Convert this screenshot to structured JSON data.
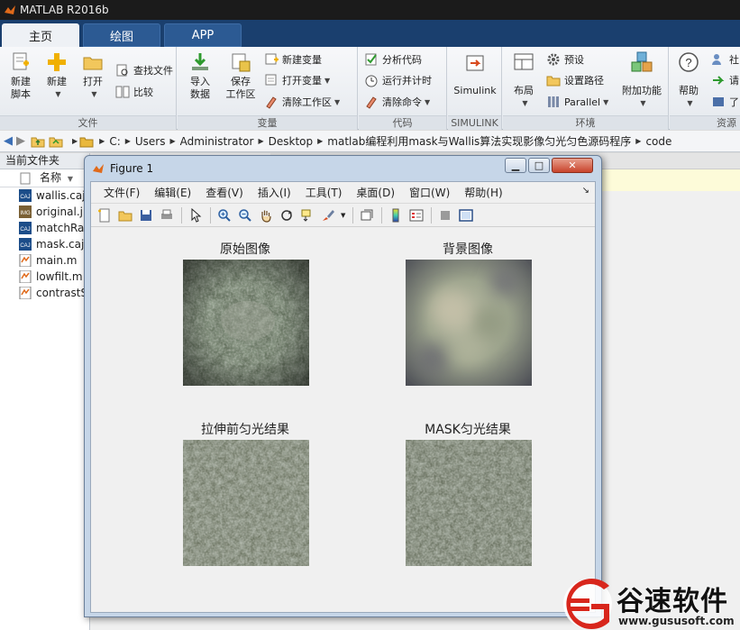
{
  "app": {
    "title": "MATLAB R2016b"
  },
  "tabs": [
    {
      "label": "主页"
    },
    {
      "label": "绘图"
    },
    {
      "label": "APP"
    }
  ],
  "ribbon": {
    "file_group": {
      "label": "文件",
      "new_script": "新建\n脚本",
      "new": "新建",
      "open": "打开",
      "find_files": "查找文件",
      "compare": "比较"
    },
    "variable_group": {
      "label": "变量",
      "import_data": "导入\n数据",
      "save_workspace": "保存\n工作区",
      "new_variable": "新建变量",
      "open_variable": "打开变量",
      "clear_workspace": "清除工作区"
    },
    "code_group": {
      "label": "代码",
      "analyze_code": "分析代码",
      "run_and_time": "运行并计时",
      "clear_commands": "清除命令"
    },
    "simulink_group": {
      "label": "SIMULINK",
      "simulink": "Simulink"
    },
    "env_group": {
      "label": "环境",
      "layout": "布局",
      "preferences": "预设",
      "set_path": "设置路径",
      "parallel": "Parallel",
      "addons": "附加功能"
    },
    "resources_group": {
      "label": "资源",
      "help": "帮助",
      "community": "社",
      "request": "请",
      "learn": "了"
    }
  },
  "address": {
    "segments": [
      "C:",
      "Users",
      "Administrator",
      "Desktop",
      "matlab编程利用mask与Wallis算法实现影像匀光匀色源码程序",
      "code"
    ]
  },
  "file_panel": {
    "title": "当前文件夹",
    "column": "名称",
    "files": [
      {
        "name": "wallis.caj",
        "icon": "caj-file-icon"
      },
      {
        "name": "original.j",
        "icon": "image-file-icon"
      },
      {
        "name": "matchRa",
        "icon": "caj-file-icon"
      },
      {
        "name": "mask.caj",
        "icon": "caj-file-icon"
      },
      {
        "name": "main.m",
        "icon": "m-file-icon"
      },
      {
        "name": "lowfilt.m",
        "icon": "m-file-icon"
      },
      {
        "name": "contrastS",
        "icon": "m-file-icon"
      }
    ]
  },
  "figure": {
    "title": "Figure 1",
    "menu": [
      "文件(F)",
      "编辑(E)",
      "查看(V)",
      "插入(I)",
      "工具(T)",
      "桌面(D)",
      "窗口(W)",
      "帮助(H)"
    ],
    "axes": [
      {
        "title": "原始图像",
        "kind": "original"
      },
      {
        "title": "背景图像",
        "kind": "background"
      },
      {
        "title": "拉伸前匀光结果",
        "kind": "pre-stretch"
      },
      {
        "title": "MASK匀光结果",
        "kind": "mask-result"
      }
    ]
  },
  "watermark": {
    "brand": "谷速软件",
    "url": "www.gususoft.com"
  },
  "colors": {
    "titlebar": "#1b1b1b",
    "tabbar": "#1a3f6e",
    "ribbon": "#eef1f5",
    "figure_frame": "#c6d6e8",
    "watermark_red": "#d8261c"
  }
}
